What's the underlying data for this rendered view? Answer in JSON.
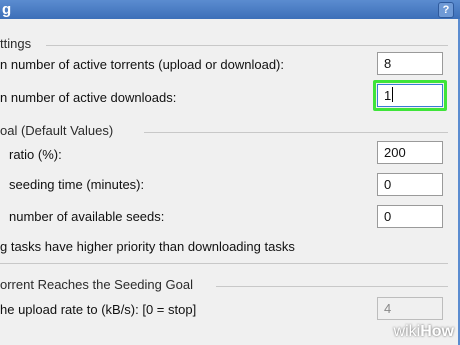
{
  "window": {
    "title": "g",
    "help_glyph": "?"
  },
  "sections": {
    "settings": "ttings",
    "seeding_goal": "oal (Default Values)",
    "reaches_goal": "orrent Reaches the Seeding Goal"
  },
  "rows": {
    "active_torrents": {
      "label": "n number of active torrents (upload or download):",
      "value": "8"
    },
    "active_downloads": {
      "label": "n number of active downloads:",
      "value": "1"
    },
    "ratio": {
      "label": "ratio (%):",
      "value": "200"
    },
    "seeding_time": {
      "label": "seeding time (minutes):",
      "value": "0"
    },
    "available_seeds": {
      "label": "number of available seeds:",
      "value": "0"
    },
    "priority_note": {
      "label": "g tasks have higher priority than downloading tasks"
    },
    "upload_rate": {
      "label": "he upload rate to (kB/s): [0 = stop]",
      "value": "4"
    }
  },
  "watermark": {
    "prefix": "wiki",
    "suffix": "How"
  },
  "colors": {
    "focus": "#3ee43a",
    "titlebar": "#3c6fb8"
  }
}
